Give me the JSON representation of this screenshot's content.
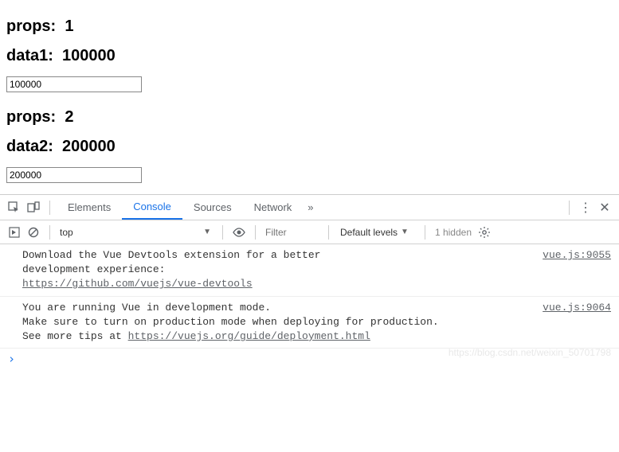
{
  "content": {
    "block1": {
      "props_label": "props:",
      "props_value": "1",
      "data_label": "data1:",
      "data_value": "100000",
      "input_value": "100000"
    },
    "block2": {
      "props_label": "props:",
      "props_value": "2",
      "data_label": "data2:",
      "data_value": "200000",
      "input_value": "200000"
    }
  },
  "devtools": {
    "tabs": {
      "elements": "Elements",
      "console": "Console",
      "sources": "Sources",
      "network": "Network",
      "more": "»"
    },
    "toolbar": {
      "context": "top",
      "filter_placeholder": "Filter",
      "levels": "Default levels",
      "hidden": "1 hidden"
    },
    "messages": {
      "msg1": {
        "text_line1": "Download the Vue Devtools extension for a better",
        "text_line2": "development experience:",
        "link": "https://github.com/vuejs/vue-devtools",
        "source": "vue.js:9055"
      },
      "msg2": {
        "text_line1": "You are running Vue in development mode.",
        "text_line2": "Make sure to turn on production mode when deploying for production.",
        "text_line3": "See more tips at ",
        "link": "https://vuejs.org/guide/deployment.html",
        "source": "vue.js:9064"
      }
    },
    "prompt": "›"
  },
  "watermark": "https://blog.csdn.net/weixin_50701798"
}
